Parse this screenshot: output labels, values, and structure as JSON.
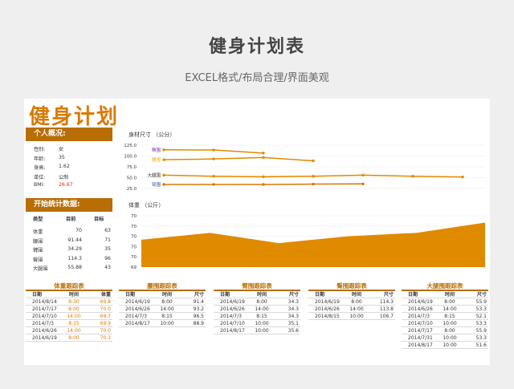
{
  "page": {
    "title": "健身计划表",
    "subtitle": "EXCEL格式/布局合理/界面美观"
  },
  "sheet": {
    "title": "健身计划",
    "profile": {
      "header": "个人概况:",
      "items": [
        {
          "label": "性别:",
          "value": "女"
        },
        {
          "label": "年龄:",
          "value": "35"
        },
        {
          "label": "身高:",
          "value": "1.62"
        },
        {
          "label": "单位:",
          "value": "公制"
        },
        {
          "label": "BMI:",
          "value": "26.67"
        }
      ]
    },
    "stats": {
      "header": "开始统计数据:",
      "columns": [
        "类型",
        "目前",
        "目标"
      ],
      "rows": [
        [
          "体重",
          "70",
          "63"
        ],
        [
          "腰围",
          "91.44",
          "71"
        ],
        [
          "臂围",
          "34.29",
          "35"
        ],
        [
          "臀围",
          "114.3",
          "96"
        ],
        [
          "大腿围",
          "55.88",
          "43"
        ]
      ]
    },
    "colors": {
      "accent": "#b86e05",
      "accent_light": "#e08a00",
      "bmi": "#e02020"
    }
  },
  "chart_data": [
    {
      "type": "line",
      "title": "身材尺寸 （公分）",
      "yticks": [
        "125.0",
        "100.0",
        "75.0",
        "50.0",
        "25.0"
      ],
      "ylim": [
        25,
        125
      ],
      "series": [
        {
          "name": "臀围",
          "values": [
            114.3,
            113.8,
            106.7
          ]
        },
        {
          "name": "腰围",
          "values": [
            91.4,
            93.2,
            96.5,
            88.9
          ]
        },
        {
          "name": "大腿围",
          "values": [
            55.9,
            53.3,
            52.1,
            53.3,
            55.9,
            53.3,
            51.6
          ]
        },
        {
          "name": "臂围",
          "values": [
            34.3,
            34.3,
            34.3,
            35.1,
            35.6
          ]
        }
      ]
    },
    {
      "type": "area",
      "title": "体重 （公斤）",
      "yticks": [
        "70",
        "70",
        "70",
        "70",
        "70",
        "69"
      ],
      "values": [
        69.8,
        70.0,
        69.7,
        69.9,
        70.0,
        70.3
      ]
    }
  ],
  "trackers": [
    {
      "title": "体重跟踪表",
      "columns": [
        "日期",
        "时间",
        "体重"
      ],
      "rows": [
        [
          "2014/8/14",
          "8:30",
          "69.8"
        ],
        [
          "2014/7/17",
          "8:00",
          "70.0"
        ],
        [
          "2014/7/10",
          "14:00",
          "69.7"
        ],
        [
          "2014/7/3",
          "8:15",
          "69.9"
        ],
        [
          "2014/6/26",
          "14:00",
          "70.0"
        ],
        [
          "2014/6/19",
          "8:00",
          "70.3"
        ]
      ]
    },
    {
      "title": "腰围跟踪表",
      "columns": [
        "日期",
        "时间",
        "尺寸"
      ],
      "rows": [
        [
          "2014/6/19",
          "8:00",
          "91.4"
        ],
        [
          "2014/6/26",
          "14:00",
          "93.2"
        ],
        [
          "2014/7/3",
          "8:15",
          "96.5"
        ],
        [
          "2014/8/17",
          "10:00",
          "88.9"
        ]
      ]
    },
    {
      "title": "臂围跟踪表",
      "columns": [
        "日期",
        "时间",
        "尺寸"
      ],
      "rows": [
        [
          "2014/6/19",
          "8:00",
          "34.3"
        ],
        [
          "2014/6/26",
          "14:00",
          "34.3"
        ],
        [
          "2014/7/3",
          "8:15",
          "34.3"
        ],
        [
          "2014/7/10",
          "10:00",
          "35.1"
        ],
        [
          "2014/8/17",
          "10:00",
          "35.6"
        ]
      ]
    },
    {
      "title": "臀围跟踪表",
      "columns": [
        "日期",
        "时间",
        "尺寸"
      ],
      "rows": [
        [
          "2014/6/19",
          "8:00",
          "114.3"
        ],
        [
          "2014/6/26",
          "14:00",
          "113.8"
        ],
        [
          "2014/8/15",
          "10:00",
          "106.7"
        ]
      ]
    },
    {
      "title": "大腿围跟踪表",
      "columns": [
        "日期",
        "时间",
        "尺寸"
      ],
      "rows": [
        [
          "2014/6/19",
          "8:00",
          "55.9"
        ],
        [
          "2014/6/26",
          "14:00",
          "53.3"
        ],
        [
          "2014/7/3",
          "8:15",
          "52.1"
        ],
        [
          "2014/7/10",
          "10:00",
          "53.3"
        ],
        [
          "2014/7/17",
          "8:00",
          "55.9"
        ],
        [
          "2014/7/31",
          "10:00",
          "53.3"
        ],
        [
          "2014/8/17",
          "10:00",
          "51.6"
        ]
      ]
    }
  ]
}
